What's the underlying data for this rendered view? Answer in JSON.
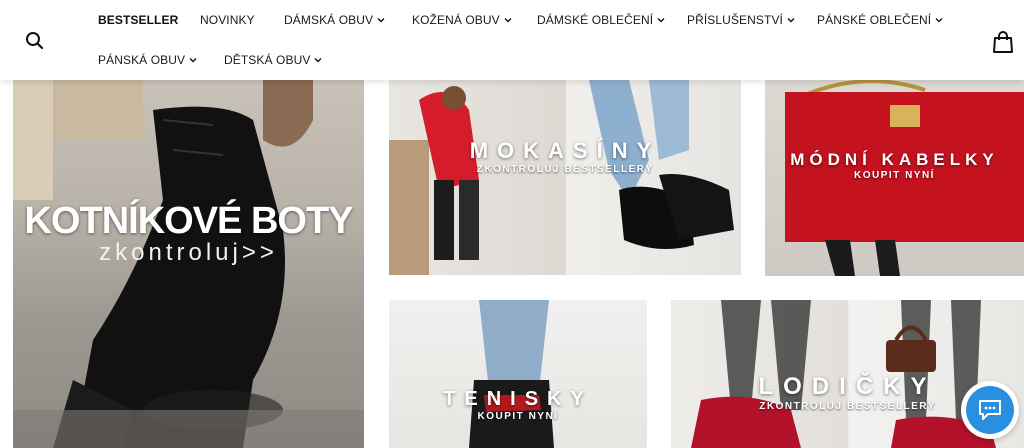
{
  "header": {
    "nav": [
      {
        "label": "BESTSELLER",
        "has_dropdown": false
      },
      {
        "label": "NOVINKY",
        "has_dropdown": false
      },
      {
        "label": "DÁMSKÁ OBUV",
        "has_dropdown": true
      },
      {
        "label": "KOŽENÁ OBUV",
        "has_dropdown": true
      },
      {
        "label": "DÁMSKÉ OBLEČENÍ",
        "has_dropdown": true
      },
      {
        "label": "PŘÍSLUŠENSTVÍ",
        "has_dropdown": true
      },
      {
        "label": "PÁNSKÉ OBLEČENÍ",
        "has_dropdown": true
      },
      {
        "label": "PÁNSKÁ OBUV",
        "has_dropdown": true
      },
      {
        "label": "DĚTSKÁ OBUV",
        "has_dropdown": true
      }
    ],
    "icons": {
      "search": "search-icon",
      "cart": "shopping-bag-icon"
    }
  },
  "tiles": {
    "boots": {
      "title": "KOTNÍKOVÉ BOTY",
      "subtitle": "zkontroluj>>"
    },
    "loafers": {
      "title": "MOKASÍNY",
      "subtitle": "ZKONTROLUJ BESTSELLERY"
    },
    "bags": {
      "title": "MÓDNÍ KABELKY",
      "subtitle": "KOUPIT NYNÍ"
    },
    "sneakers": {
      "title": "TENISKY",
      "subtitle": "KOUPIT NYNÍ"
    },
    "pumps": {
      "title": "LODIČKY",
      "subtitle": "ZKONTROLUJ BESTSELLERY"
    }
  },
  "chat": {
    "icon": "chat-bubble-icon",
    "color": "#2a8fe0"
  },
  "colors": {
    "accent_red": "#c8102e",
    "text": "#1a1a1a"
  }
}
